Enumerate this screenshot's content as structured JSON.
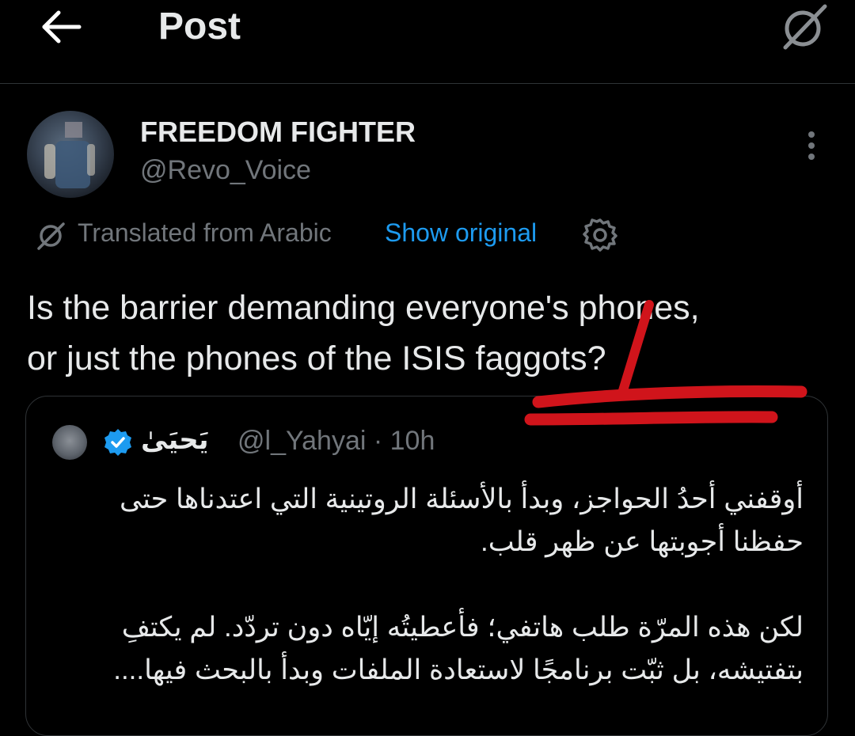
{
  "header": {
    "title": "Post",
    "back_icon": "arrow-left-icon",
    "translate_icon": "translate-icon"
  },
  "post": {
    "author": {
      "display_name": "FREEDOM FIGHTER",
      "handle": "@Revo_Voice"
    },
    "translation": {
      "label": "Translated from Arabic",
      "show_original": "Show original"
    },
    "text_line1": "Is the barrier demanding everyone's phones,",
    "text_line2": "or just the phones of the ISIS faggots?"
  },
  "quote": {
    "display_name": "يَحيَىٰ",
    "handle_time": "@l_Yahyai · 10h",
    "para1": "أوقفني أحدُ الحواجز، وبدأ بالأسئلة الروتينية التي اعتدناها حتى حفظنا أجوبتها عن ظهر قلب.",
    "para2": "لكن هذه المرّة طلب هاتفي؛ فأعطيتُه إيّاه دون تردّد. لم يكتفِ بتفتيشه، بل ثبّت برنامجًا لاستعادة الملفات وبدأ بالبحث فيها...."
  },
  "colors": {
    "background": "#000000",
    "text_primary": "#e7e9ea",
    "text_secondary": "#71767b",
    "link": "#1d9bf0",
    "verified": "#1d9bf0",
    "annotation": "#d0141b"
  }
}
